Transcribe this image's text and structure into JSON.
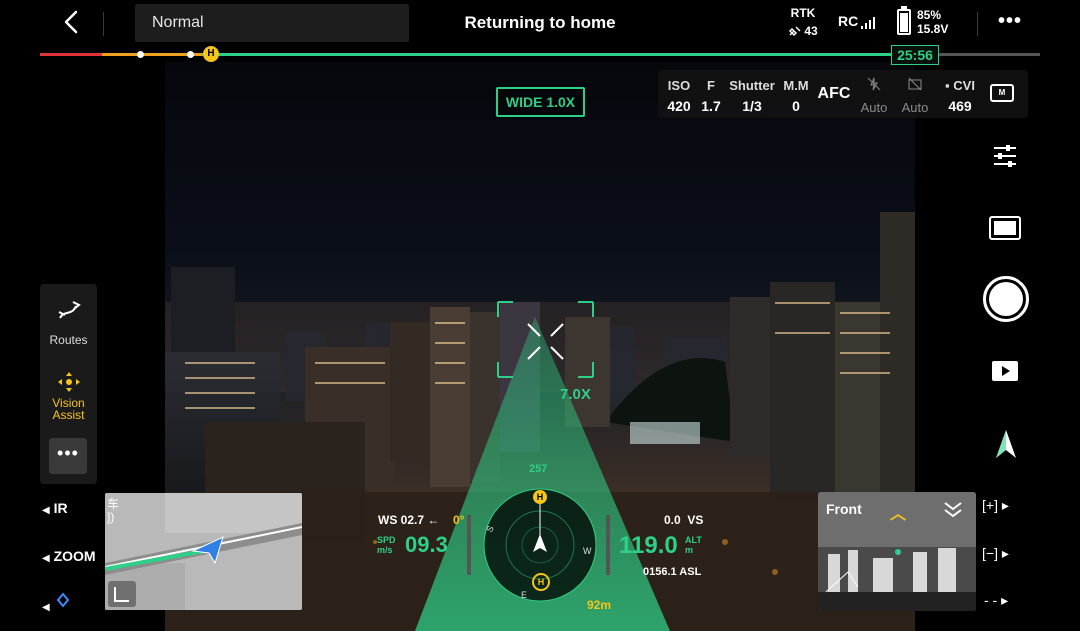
{
  "top_bar": {
    "back_icon": "chevron-left-icon",
    "mode": "Normal",
    "status": "Returning to home",
    "rtk_label": "RTK",
    "rtk_satellites": "43",
    "rc_label": "RC",
    "battery_percent": "85%",
    "battery_voltage": "15.8V",
    "battery_level": 0.85,
    "more_icon": "more-horizontal-icon",
    "more_label": "•••"
  },
  "timeline": {
    "home_marker": "H",
    "flight_time": "25:56"
  },
  "camera": {
    "lens": "WIDE  1.0X",
    "params": [
      {
        "label": "ISO",
        "value": "420"
      },
      {
        "label": "F",
        "value": "1.7"
      },
      {
        "label": "Shutter",
        "value": "1/3"
      },
      {
        "label": "M.M",
        "value": "0"
      }
    ],
    "focus_mode": "AFC",
    "auto1": "Auto",
    "auto2": "Auto",
    "storage_label": "CVI",
    "storage_value": "469",
    "mode_icon_label": "M",
    "zoom_overlay": "7.0X"
  },
  "left_panel": {
    "routes_label": "Routes",
    "vision_label_1": "Vision",
    "vision_label_2": "Assist",
    "more_label": "•••",
    "ir_label": "IR",
    "zoom_label": "ZOOM"
  },
  "map": {
    "text_fragment_1": "车",
    "text_fragment_2": "])"
  },
  "telemetry": {
    "wind": "WS 02.7",
    "gimbal_angle": "0°",
    "spd_label_1": "SPD",
    "spd_label_2": "m/s",
    "speed": "09.3",
    "heading": "257",
    "vertical_speed": "0.0",
    "vs_label": "VS",
    "altitude": "119.0",
    "alt_label_1": "ALT",
    "alt_label_2": "m",
    "asl": "0156.1 ASL",
    "home_distance": "92m",
    "compass_s": "S",
    "compass_w": "W",
    "compass_e": "E",
    "home_marker": "H"
  },
  "front_camera": {
    "label": "Front"
  },
  "right_controls": {
    "plus_label": "[+] ▸",
    "minus_label": "[−] ▸",
    "dash_label": "- - ▸"
  },
  "colors": {
    "accent_green": "#2ecf86",
    "warning_yellow": "#f5c518",
    "alert_red": "#e0333a",
    "progress_orange": "#f0a020"
  }
}
